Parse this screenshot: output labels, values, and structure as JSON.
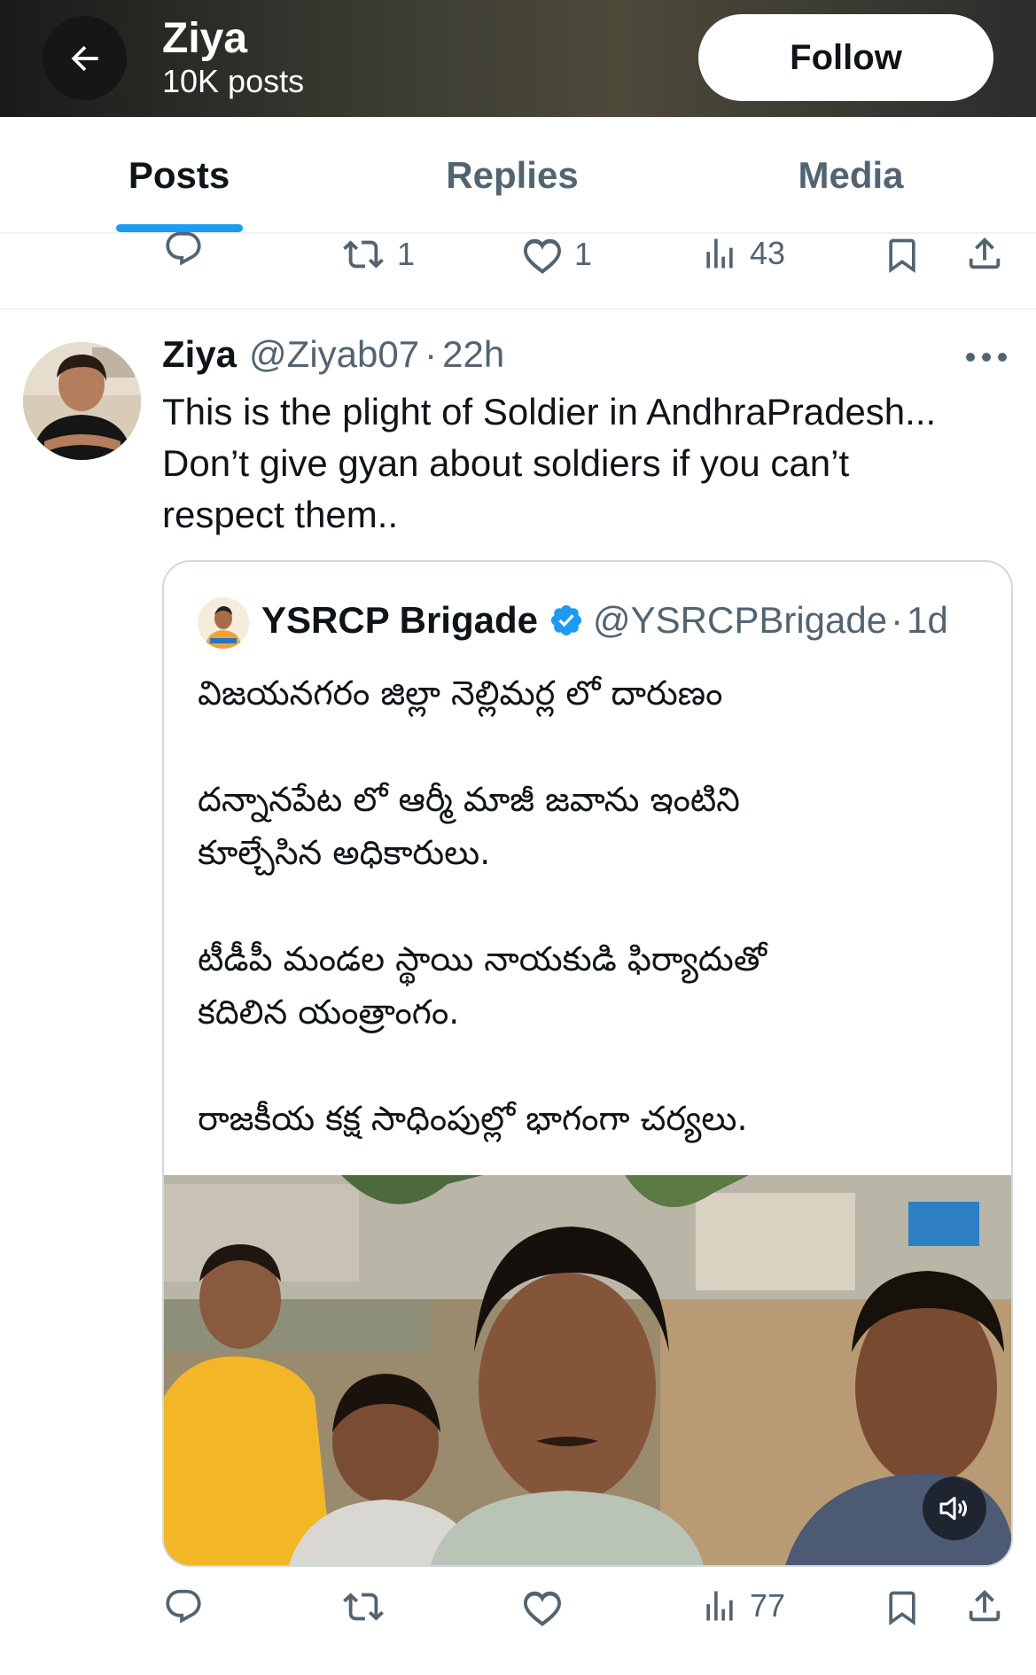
{
  "header": {
    "title": "Ziya",
    "subtitle": "10K posts",
    "follow_label": "Follow"
  },
  "tabs": [
    {
      "label": "Posts",
      "active": true
    },
    {
      "label": "Replies",
      "active": false
    },
    {
      "label": "Media",
      "active": false
    }
  ],
  "previous_post_actions": {
    "replies": "",
    "reposts": "1",
    "likes": "1",
    "views": "43"
  },
  "post": {
    "author_name": "Ziya",
    "handle": "@Ziyab07",
    "separator": "·",
    "time": "22h",
    "text_lines": [
      "This is the plight of Soldier in AndhraPradesh...",
      "Don’t give gyan about soldiers if you can’t",
      "respect them.."
    ],
    "quote": {
      "author_name": "YSRCP Brigade",
      "verified": true,
      "handle": "@YSRCPBrigade",
      "separator": "·",
      "time": "1d",
      "paragraphs": [
        [
          "విజయనగరం జిల్లా నెల్లిమర్ల లో దారుణం"
        ],
        [
          "దన్నానపేట లో ఆర్మీ మాజీ జవాను ఇంటిని",
          "కూల్చేసిన అధికారులు."
        ],
        [
          "టీడీపీ మండల స్థాయి నాయకుడి ఫిర్యాదుతో",
          "కదిలిన యంత్రాంగం."
        ],
        [
          "రాజకీయ కక్ష సాధింపుల్లో భాగంగా చర్యలు."
        ]
      ]
    },
    "actions": {
      "replies": "",
      "reposts": "",
      "likes": "",
      "views": "77"
    }
  },
  "colors": {
    "accent": "#1d9bf0",
    "secondary_text": "#536471",
    "border": "#cfd9de"
  },
  "icons": [
    "back-arrow-icon",
    "reply-icon",
    "repost-icon",
    "like-icon",
    "views-icon",
    "bookmark-icon",
    "share-icon",
    "more-icon",
    "verified-badge-icon",
    "volume-icon"
  ]
}
